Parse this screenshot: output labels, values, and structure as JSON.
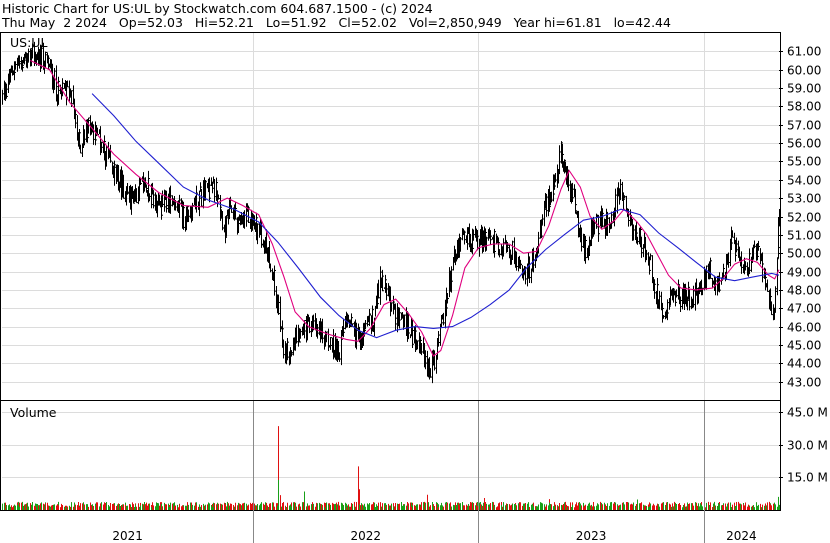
{
  "header": {
    "title_line": "Historic Chart for US:UL by Stockwatch.com 604.687.1500 - (c) 2024",
    "stats_line": "Thu May  2 2024   Op=52.03   Hi=52.21   Lo=51.92   Cl=52.02   Vol=2,850,949   Year hi=61.81   lo=42.44"
  },
  "chart_data": {
    "type": "line",
    "symbol_label": "US:UL",
    "volume_label": "Volume",
    "price_axis": {
      "min": 42,
      "max": 62,
      "ticks": [
        61,
        60,
        59,
        58,
        57,
        56,
        55,
        54,
        53,
        52,
        51,
        50,
        49,
        48,
        47,
        46,
        45,
        44,
        43
      ],
      "tick_labels": [
        "61.00",
        "60.00",
        "59.00",
        "58.00",
        "57.00",
        "56.00",
        "55.00",
        "54.00",
        "53.00",
        "52.00",
        "51.00",
        "50.00",
        "49.00",
        "48.00",
        "47.00",
        "46.00",
        "45.00",
        "44.00",
        "43.00"
      ]
    },
    "volume_axis": {
      "max": 50,
      "ticks": [
        45,
        30,
        15
      ],
      "tick_labels": [
        "45.0 M",
        "30.0 M",
        "15.0 M"
      ]
    },
    "x_axis": {
      "labels": [
        "2021",
        "2022",
        "2023",
        "2024"
      ],
      "range": [
        "2020-11-20",
        "2024-05-02"
      ],
      "year_starts": [
        "2022-01-01",
        "2023-01-01",
        "2024-01-01"
      ]
    },
    "series": [
      {
        "name": "",
        "type": "price_bars",
        "color": "#000000",
        "anchors": [
          [
            "2020-11-20",
            58.5
          ],
          [
            "2020-12-10",
            60.2
          ],
          [
            "2021-01-10",
            60.8
          ],
          [
            "2021-02-01",
            60.4
          ],
          [
            "2021-02-20",
            58.6
          ],
          [
            "2021-03-10",
            58.9
          ],
          [
            "2021-03-25",
            55.8
          ],
          [
            "2021-04-10",
            57.2
          ],
          [
            "2021-05-01",
            55.7
          ],
          [
            "2021-05-20",
            54.4
          ],
          [
            "2021-06-15",
            53.0
          ],
          [
            "2021-07-10",
            53.8
          ],
          [
            "2021-08-01",
            52.4
          ],
          [
            "2021-08-20",
            53.0
          ],
          [
            "2021-09-10",
            52.0
          ],
          [
            "2021-10-01",
            52.8
          ],
          [
            "2021-10-20",
            53.6
          ],
          [
            "2021-11-05",
            53.4
          ],
          [
            "2021-11-15",
            51.0
          ],
          [
            "2021-11-25",
            52.5
          ],
          [
            "2021-12-10",
            51.5
          ],
          [
            "2021-12-25",
            52.0
          ],
          [
            "2022-01-10",
            51.2
          ],
          [
            "2022-01-25",
            50.0
          ],
          [
            "2022-02-05",
            48.2
          ],
          [
            "2022-02-20",
            44.5
          ],
          [
            "2022-03-05",
            45.2
          ],
          [
            "2022-03-20",
            45.5
          ],
          [
            "2022-04-05",
            46.3
          ],
          [
            "2022-04-20",
            45.8
          ],
          [
            "2022-05-05",
            45.0
          ],
          [
            "2022-05-20",
            44.8
          ],
          [
            "2022-06-05",
            46.8
          ],
          [
            "2022-06-20",
            45.0
          ],
          [
            "2022-07-01",
            45.8
          ],
          [
            "2022-07-15",
            46.5
          ],
          [
            "2022-07-25",
            48.7
          ],
          [
            "2022-08-05",
            48.0
          ],
          [
            "2022-08-20",
            46.6
          ],
          [
            "2022-09-05",
            46.2
          ],
          [
            "2022-09-20",
            45.2
          ],
          [
            "2022-10-01",
            44.7
          ],
          [
            "2022-10-12",
            43.6
          ],
          [
            "2022-10-22",
            44.3
          ],
          [
            "2022-11-01",
            45.8
          ],
          [
            "2022-11-10",
            47.5
          ],
          [
            "2022-11-20",
            49.3
          ],
          [
            "2022-12-01",
            50.8
          ],
          [
            "2022-12-15",
            50.9
          ],
          [
            "2023-01-01",
            50.7
          ],
          [
            "2023-01-20",
            50.8
          ],
          [
            "2023-02-10",
            50.4
          ],
          [
            "2023-03-01",
            50.0
          ],
          [
            "2023-03-15",
            49.0
          ],
          [
            "2023-03-25",
            49.3
          ],
          [
            "2023-04-05",
            50.3
          ],
          [
            "2023-04-20",
            52.6
          ],
          [
            "2023-05-05",
            54.0
          ],
          [
            "2023-05-15",
            55.6
          ],
          [
            "2023-05-25",
            54.0
          ],
          [
            "2023-06-05",
            52.6
          ],
          [
            "2023-06-15",
            51.0
          ],
          [
            "2023-06-25",
            50.0
          ],
          [
            "2023-07-05",
            51.5
          ],
          [
            "2023-07-20",
            51.8
          ],
          [
            "2023-08-01",
            51.2
          ],
          [
            "2023-08-15",
            53.5
          ],
          [
            "2023-08-25",
            52.7
          ],
          [
            "2023-09-05",
            51.5
          ],
          [
            "2023-09-20",
            50.7
          ],
          [
            "2023-10-01",
            50.0
          ],
          [
            "2023-10-15",
            48.0
          ],
          [
            "2023-10-28",
            46.8
          ],
          [
            "2023-11-10",
            47.9
          ],
          [
            "2023-11-25",
            47.6
          ],
          [
            "2023-12-10",
            47.6
          ],
          [
            "2023-12-28",
            48.3
          ],
          [
            "2024-01-10",
            49.1
          ],
          [
            "2024-01-25",
            48.0
          ],
          [
            "2024-02-05",
            49.0
          ],
          [
            "2024-02-15",
            50.7
          ],
          [
            "2024-02-25",
            50.1
          ],
          [
            "2024-03-10",
            49.3
          ],
          [
            "2024-03-25",
            50.3
          ],
          [
            "2024-04-05",
            49.2
          ],
          [
            "2024-04-15",
            47.5
          ],
          [
            "2024-04-22",
            46.4
          ],
          [
            "2024-04-27",
            48.3
          ],
          [
            "2024-05-02",
            52.0
          ]
        ]
      },
      {
        "name": "",
        "type": "moving_average_short",
        "color": "#e0007f",
        "points": [
          [
            "2021-01-05",
            60.5
          ],
          [
            "2021-02-05",
            60.0
          ],
          [
            "2021-03-10",
            58.2
          ],
          [
            "2021-04-15",
            56.8
          ],
          [
            "2021-05-20",
            55.4
          ],
          [
            "2021-06-25",
            54.3
          ],
          [
            "2021-08-01",
            53.3
          ],
          [
            "2021-09-10",
            52.6
          ],
          [
            "2021-10-20",
            52.5
          ],
          [
            "2021-11-20",
            53.0
          ],
          [
            "2021-12-15",
            52.6
          ],
          [
            "2022-01-10",
            52.1
          ],
          [
            "2022-02-01",
            50.5
          ],
          [
            "2022-02-20",
            48.7
          ],
          [
            "2022-03-10",
            46.8
          ],
          [
            "2022-04-01",
            46.0
          ],
          [
            "2022-05-01",
            45.6
          ],
          [
            "2022-06-01",
            45.3
          ],
          [
            "2022-06-20",
            45.2
          ],
          [
            "2022-07-10",
            45.9
          ],
          [
            "2022-08-01",
            47.2
          ],
          [
            "2022-08-20",
            47.5
          ],
          [
            "2022-09-10",
            46.7
          ],
          [
            "2022-10-01",
            45.7
          ],
          [
            "2022-10-20",
            44.4
          ],
          [
            "2022-11-01",
            44.7
          ],
          [
            "2022-11-20",
            46.6
          ],
          [
            "2022-12-10",
            49.2
          ],
          [
            "2023-01-01",
            50.3
          ],
          [
            "2023-01-25",
            50.5
          ],
          [
            "2023-02-20",
            50.5
          ],
          [
            "2023-03-15",
            50.0
          ],
          [
            "2023-04-05",
            50.1
          ],
          [
            "2023-04-25",
            51.5
          ],
          [
            "2023-05-15",
            53.5
          ],
          [
            "2023-05-28",
            54.5
          ],
          [
            "2023-06-15",
            53.6
          ],
          [
            "2023-07-01",
            52.0
          ],
          [
            "2023-07-20",
            51.3
          ],
          [
            "2023-08-10",
            51.8
          ],
          [
            "2023-08-25",
            52.4
          ],
          [
            "2023-09-15",
            51.7
          ],
          [
            "2023-10-01",
            51.0
          ],
          [
            "2023-10-20",
            49.8
          ],
          [
            "2023-11-05",
            48.8
          ],
          [
            "2023-11-25",
            48.1
          ],
          [
            "2023-12-20",
            48.0
          ],
          [
            "2024-01-15",
            48.1
          ],
          [
            "2024-02-01",
            48.6
          ],
          [
            "2024-02-20",
            49.4
          ],
          [
            "2024-03-10",
            49.7
          ],
          [
            "2024-03-28",
            49.5
          ],
          [
            "2024-04-15",
            48.8
          ],
          [
            "2024-04-25",
            48.6
          ],
          [
            "2024-05-02",
            49.1
          ]
        ]
      },
      {
        "name": "",
        "type": "moving_average_long",
        "color": "#1f1fd0",
        "points": [
          [
            "2021-04-15",
            58.7
          ],
          [
            "2021-05-20",
            57.5
          ],
          [
            "2021-06-25",
            56.1
          ],
          [
            "2021-08-01",
            54.9
          ],
          [
            "2021-09-10",
            53.6
          ],
          [
            "2021-10-20",
            52.9
          ],
          [
            "2021-12-01",
            52.4
          ],
          [
            "2022-01-10",
            51.7
          ],
          [
            "2022-02-10",
            50.6
          ],
          [
            "2022-03-15",
            49.2
          ],
          [
            "2022-04-20",
            47.6
          ],
          [
            "2022-05-20",
            46.6
          ],
          [
            "2022-06-20",
            45.8
          ],
          [
            "2022-07-20",
            45.4
          ],
          [
            "2022-08-20",
            45.8
          ],
          [
            "2022-09-20",
            46.0
          ],
          [
            "2022-10-20",
            45.9
          ],
          [
            "2022-11-20",
            46.0
          ],
          [
            "2022-12-20",
            46.5
          ],
          [
            "2023-01-20",
            47.2
          ],
          [
            "2023-02-20",
            48.0
          ],
          [
            "2023-03-20",
            49.2
          ],
          [
            "2023-04-20",
            50.2
          ],
          [
            "2023-05-20",
            51.0
          ],
          [
            "2023-06-20",
            51.8
          ],
          [
            "2023-07-20",
            52.0
          ],
          [
            "2023-08-20",
            52.4
          ],
          [
            "2023-09-20",
            52.1
          ],
          [
            "2023-10-20",
            51.1
          ],
          [
            "2023-11-20",
            50.3
          ],
          [
            "2023-12-20",
            49.5
          ],
          [
            "2024-01-20",
            48.7
          ],
          [
            "2024-02-20",
            48.5
          ],
          [
            "2024-03-20",
            48.7
          ],
          [
            "2024-04-20",
            48.9
          ],
          [
            "2024-05-02",
            48.8
          ]
        ]
      },
      {
        "name": "",
        "type": "volume",
        "up_color": "#18a018",
        "down_color": "#e01010",
        "typical_millions": 2.5,
        "spikes_millions": [
          [
            "2022-02-10",
            38.5
          ],
          [
            "2022-02-11",
            13.8
          ],
          [
            "2022-02-14",
            6.8
          ],
          [
            "2022-03-25",
            8.5
          ],
          [
            "2022-06-20",
            20.0
          ],
          [
            "2022-06-21",
            9.5
          ],
          [
            "2022-10-10",
            7.0
          ],
          [
            "2023-01-10",
            5.5
          ],
          [
            "2023-04-25",
            5.0
          ],
          [
            "2023-09-15",
            4.8
          ],
          [
            "2024-04-28",
            5.5
          ],
          [
            "2024-05-01",
            6.0
          ]
        ]
      }
    ]
  }
}
